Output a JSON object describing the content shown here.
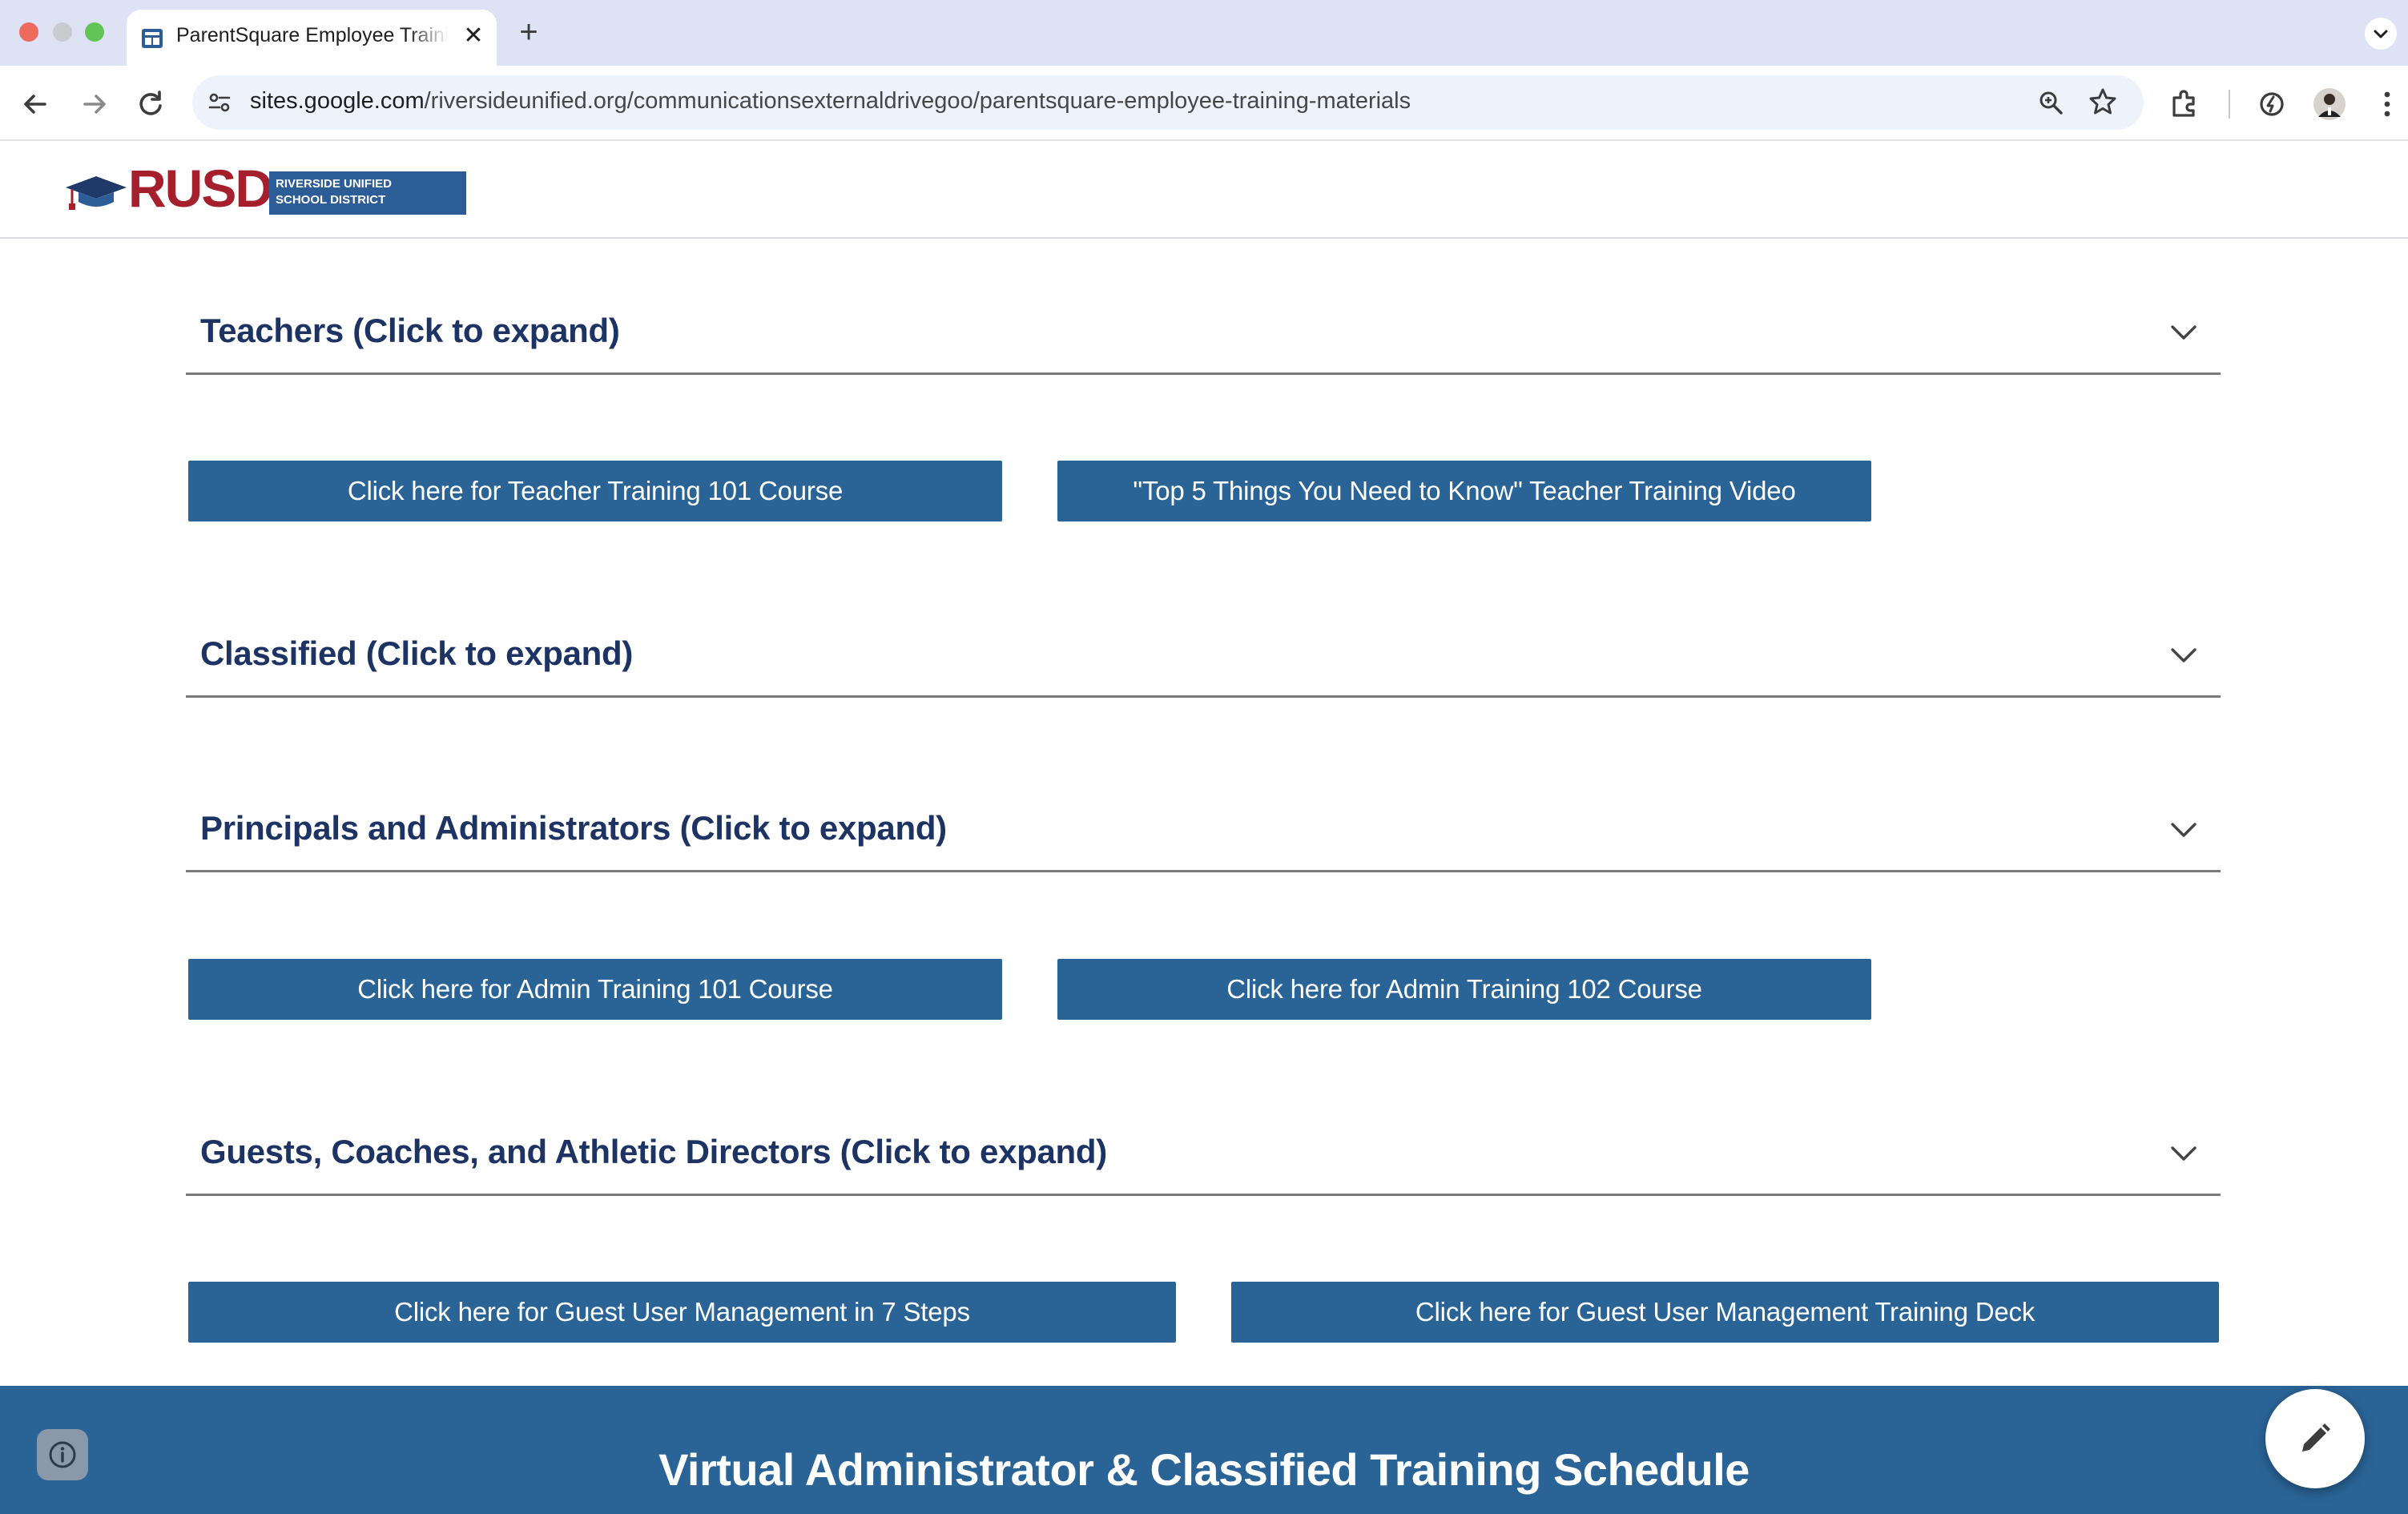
{
  "browser": {
    "tab_title": "ParentSquare Employee Training Materials",
    "tab_close": "✕",
    "new_tab": "+",
    "url_host": "sites.google.com",
    "url_path": "/riversideunified.org/communicationsexternaldrivegoo/parentsquare-employee-training-materials"
  },
  "header": {
    "logo_text": "RUSD",
    "logo_line1": "RIVERSIDE UNIFIED",
    "logo_line2": "SCHOOL DISTRICT"
  },
  "sections": [
    {
      "title": "Teachers (Click to expand)",
      "buttons": [
        "Click here for Teacher Training 101 Course",
        "\"Top 5 Things You Need to Know\" Teacher Training Video"
      ]
    },
    {
      "title": "Classified (Click to expand)",
      "buttons": []
    },
    {
      "title": "Principals and Administrators (Click to expand)",
      "buttons": [
        "Click here for Admin Training 101 Course",
        "Click here for Admin Training 102 Course"
      ]
    },
    {
      "title": "Guests, Coaches, and Athletic Directors (Click to expand)",
      "buttons": [
        "Click here for Guest User Management in 7 Steps",
        "Click here for Guest User Management Training Deck"
      ]
    }
  ],
  "footer": {
    "title": "Virtual Administrator & Classified Training Schedule"
  },
  "colors": {
    "button_bg": "#2a6497",
    "heading": "#1d3363",
    "logo_red": "#a51f2c",
    "logo_blue": "#2c5d96"
  },
  "icons": [
    "back-arrow-icon",
    "forward-arrow-icon",
    "reload-icon",
    "site-info-icon",
    "zoom-icon",
    "star-icon",
    "extensions-icon",
    "performance-icon",
    "avatar",
    "menu-dots-icon",
    "chevron-down-icon",
    "info-icon",
    "pencil-icon"
  ]
}
